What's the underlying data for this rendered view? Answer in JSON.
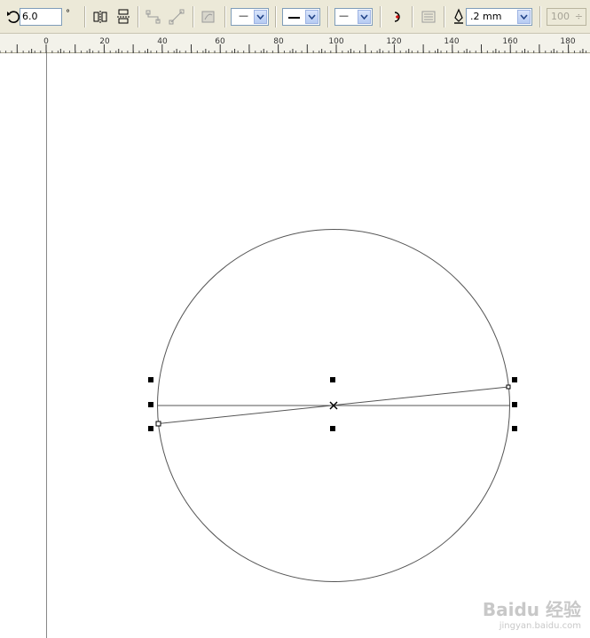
{
  "toolbar": {
    "rotation_value": "6.0",
    "degree_symbol": "°",
    "line_style_start": "—",
    "line_style_end": "—",
    "outline_width": ".2 mm",
    "scale_value": "100"
  },
  "ruler": {
    "labels": [
      "0",
      "20",
      "40",
      "60",
      "80",
      "100",
      "120",
      "140",
      "160",
      "180"
    ]
  },
  "colors": {
    "toolbar_bg": "#ece9d8",
    "canvas_bg": "#ffffff",
    "shape_stroke": "#555555"
  },
  "watermark": {
    "main": "Baidu 经验",
    "url": "jingyan.baidu.com"
  }
}
